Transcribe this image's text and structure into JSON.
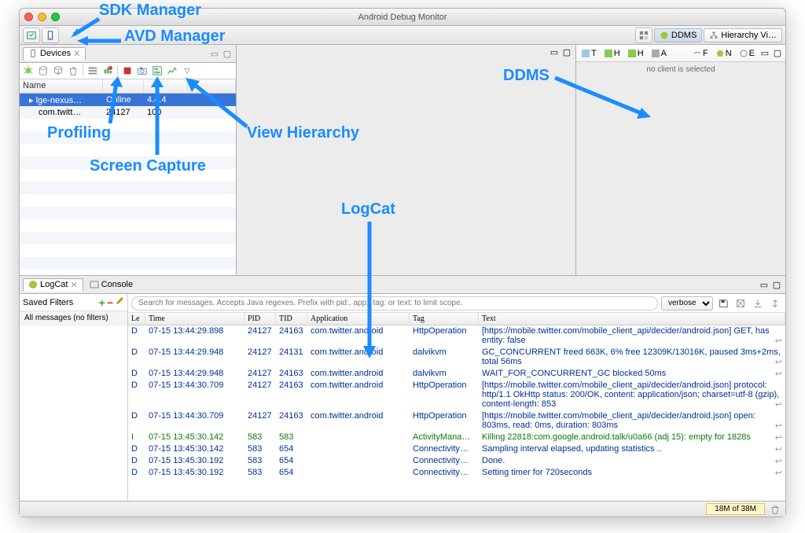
{
  "window": {
    "title": "Android Debug Monitor"
  },
  "toolbar": {
    "sdk_manager_tip": "SDK Manager",
    "avd_manager_tip": "AVD Manager"
  },
  "perspectives": {
    "ddms": "DDMS",
    "hierarchy": "Hierarchy Vi…"
  },
  "devices": {
    "tab_title": "Devices",
    "columns": {
      "name": "Name"
    },
    "rows": [
      {
        "name": "lge-nexus…",
        "status": "Online",
        "ver": "4.4.4",
        "extra": "",
        "selected": true
      },
      {
        "name": "com.twitt…",
        "status": "24127",
        "ver": "100",
        "extra": ""
      }
    ]
  },
  "threads_panel": {
    "tabs": [
      "T",
      "H",
      "H",
      "A",
      "F",
      "N",
      "E"
    ],
    "empty_text": "no client is selected"
  },
  "logcat": {
    "tab_logcat": "LogCat",
    "tab_console": "Console",
    "filters_label": "Saved Filters",
    "filter_all": "All messages (no filters)",
    "search_placeholder": "Search for messages. Accepts Java regexes. Prefix with pid:, app:, tag: or text: to limit scope.",
    "level": "verbose",
    "columns": {
      "lv": "Le",
      "time": "Time",
      "pid": "PID",
      "tid": "TID",
      "app": "Application",
      "tag": "Tag",
      "text": "Text"
    },
    "rows": [
      {
        "lv": "D",
        "time": "07-15 13:44:29.898",
        "pid": "24127",
        "tid": "24163",
        "app": "com.twitter.android",
        "tag": "HttpOperation",
        "text": "[https://mobile.twitter.com/mobile_client_api/decider/android.json] GET, has entity: false"
      },
      {
        "lv": "D",
        "time": "07-15 13:44:29.948",
        "pid": "24127",
        "tid": "24131",
        "app": "com.twitter.android",
        "tag": "dalvikvm",
        "text": "GC_CONCURRENT freed 663K, 6% free 12309K/13016K, paused 3ms+2ms, total 56ms"
      },
      {
        "lv": "D",
        "time": "07-15 13:44:29.948",
        "pid": "24127",
        "tid": "24163",
        "app": "com.twitter.android",
        "tag": "dalvikvm",
        "text": "WAIT_FOR_CONCURRENT_GC blocked 50ms"
      },
      {
        "lv": "D",
        "time": "07-15 13:44:30.709",
        "pid": "24127",
        "tid": "24163",
        "app": "com.twitter.android",
        "tag": "HttpOperation",
        "text": "[https://mobile.twitter.com/mobile_client_api/decider/android.json] protocol: http/1.1 OkHttp status: 200/OK, content: application/json; charset=utf-8 (gzip), content-length: 853"
      },
      {
        "lv": "D",
        "time": "07-15 13:44:30.709",
        "pid": "24127",
        "tid": "24163",
        "app": "com.twitter.android",
        "tag": "HttpOperation",
        "text": "[https://mobile.twitter.com/mobile_client_api/decider/android.json] open: 803ms, read: 0ms, duration: 803ms"
      },
      {
        "lv": "I",
        "time": "07-15 13:45:30.142",
        "pid": "583",
        "tid": "583",
        "app": "",
        "tag": "ActivityMana…",
        "text": "Killing 22818:com.google.android.talk/u0a66 (adj 15): empty for 1828s"
      },
      {
        "lv": "D",
        "time": "07-15 13:45:30.142",
        "pid": "583",
        "tid": "654",
        "app": "",
        "tag": "Connectivity…",
        "text": "Sampling interval elapsed, updating statistics .."
      },
      {
        "lv": "D",
        "time": "07-15 13:45:30.192",
        "pid": "583",
        "tid": "654",
        "app": "",
        "tag": "Connectivity…",
        "text": "Done."
      },
      {
        "lv": "D",
        "time": "07-15 13:45:30.192",
        "pid": "583",
        "tid": "654",
        "app": "",
        "tag": "Connectivity…",
        "text": "Setting timer for 720seconds"
      }
    ]
  },
  "statusbar": {
    "memory": "18M of 38M"
  },
  "annotations": {
    "sdk": "SDK Manager",
    "avd": "AVD Manager",
    "profiling": "Profiling",
    "screen_capture": "Screen Capture",
    "view_hierarchy": "View Hierarchy",
    "logcat": "LogCat",
    "ddms": "DDMS"
  }
}
